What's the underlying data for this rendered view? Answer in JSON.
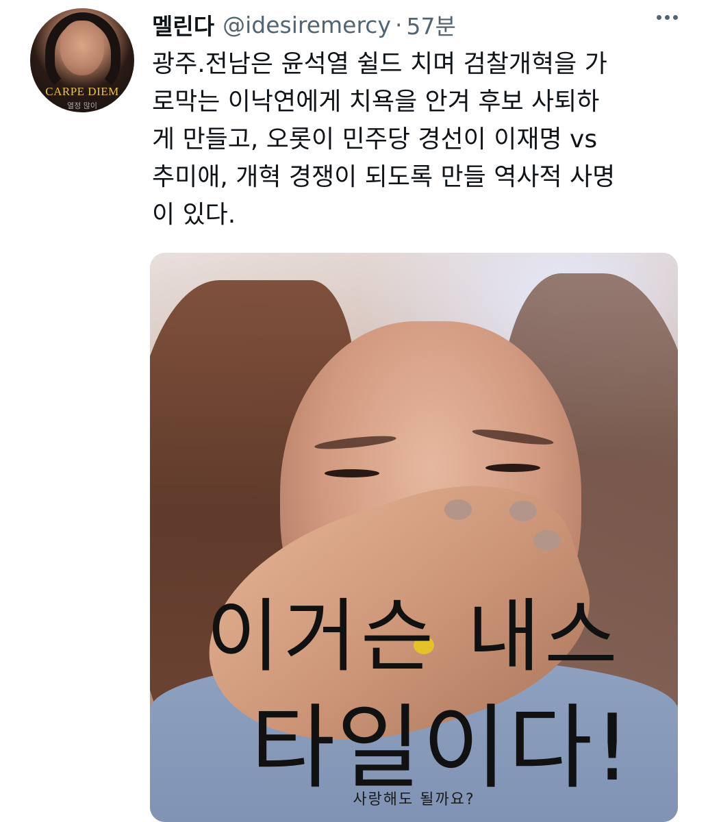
{
  "tweet": {
    "display_name": "멜린다",
    "handle": "@idesiremercy",
    "separator": "·",
    "time": "57분",
    "text": "광주.전남은 윤석열 쉴드 치며 검찰개혁을 가\n로막는 이낙연에게 치욕을 안겨 후보 사퇴하\n게 만들고, 오롯이 민주당 경선이 이재명 vs\n추미애, 개혁 경쟁이 되도록 만들 역사적 사명\n이 있다."
  },
  "avatar": {
    "caption": "CARPE DIEM",
    "subcaption": "열정 많이"
  },
  "media": {
    "overlay_line_1": "이거슨 내스",
    "overlay_line_2": "타일이다!",
    "caption": "사랑해도 될까요?"
  },
  "icons": {
    "more": "more-horizontal-icon"
  },
  "colors": {
    "text_primary": "#0f1419",
    "text_secondary": "#536471",
    "background": "#ffffff"
  }
}
